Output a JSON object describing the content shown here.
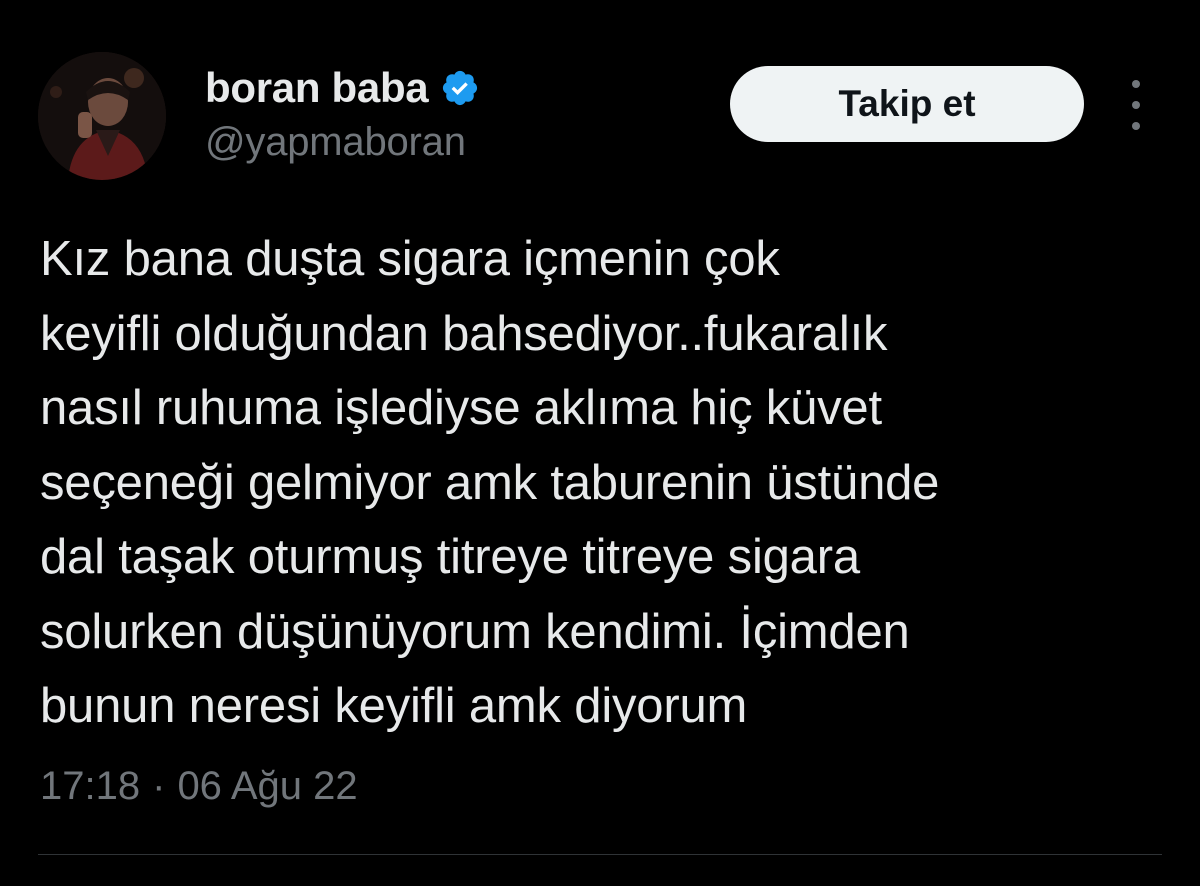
{
  "author": {
    "display_name": "boran baba",
    "handle": "@yapmaboran",
    "verified_icon": "verified-badge-icon",
    "avatar": "profile-photo"
  },
  "actions": {
    "follow_label": "Takip et",
    "more_icon": "more-vertical-icon"
  },
  "tweet": {
    "lines": [
      "Kız bana duşta sigara içmenin çok",
      "keyifli olduğundan bahsediyor..fukaralık",
      "nasıl ruhuma işlediyse aklıma hiç küvet",
      "seçeneği gelmiyor amk taburenin üstünde",
      "dal taşak oturmuş titreye titreye sigara",
      "solurken düşünüyorum kendimi. İçimden",
      "bunun neresi keyifli amk diyorum"
    ],
    "time": "17:18",
    "separator": "·",
    "date": "06 Ağu 22"
  },
  "colors": {
    "background": "#000000",
    "text_primary": "#e7e9ea",
    "text_secondary": "#71767b",
    "verified_blue": "#1d9bf0",
    "button_bg": "#eff3f4",
    "button_text": "#0f1419",
    "divider": "#2f3336"
  }
}
